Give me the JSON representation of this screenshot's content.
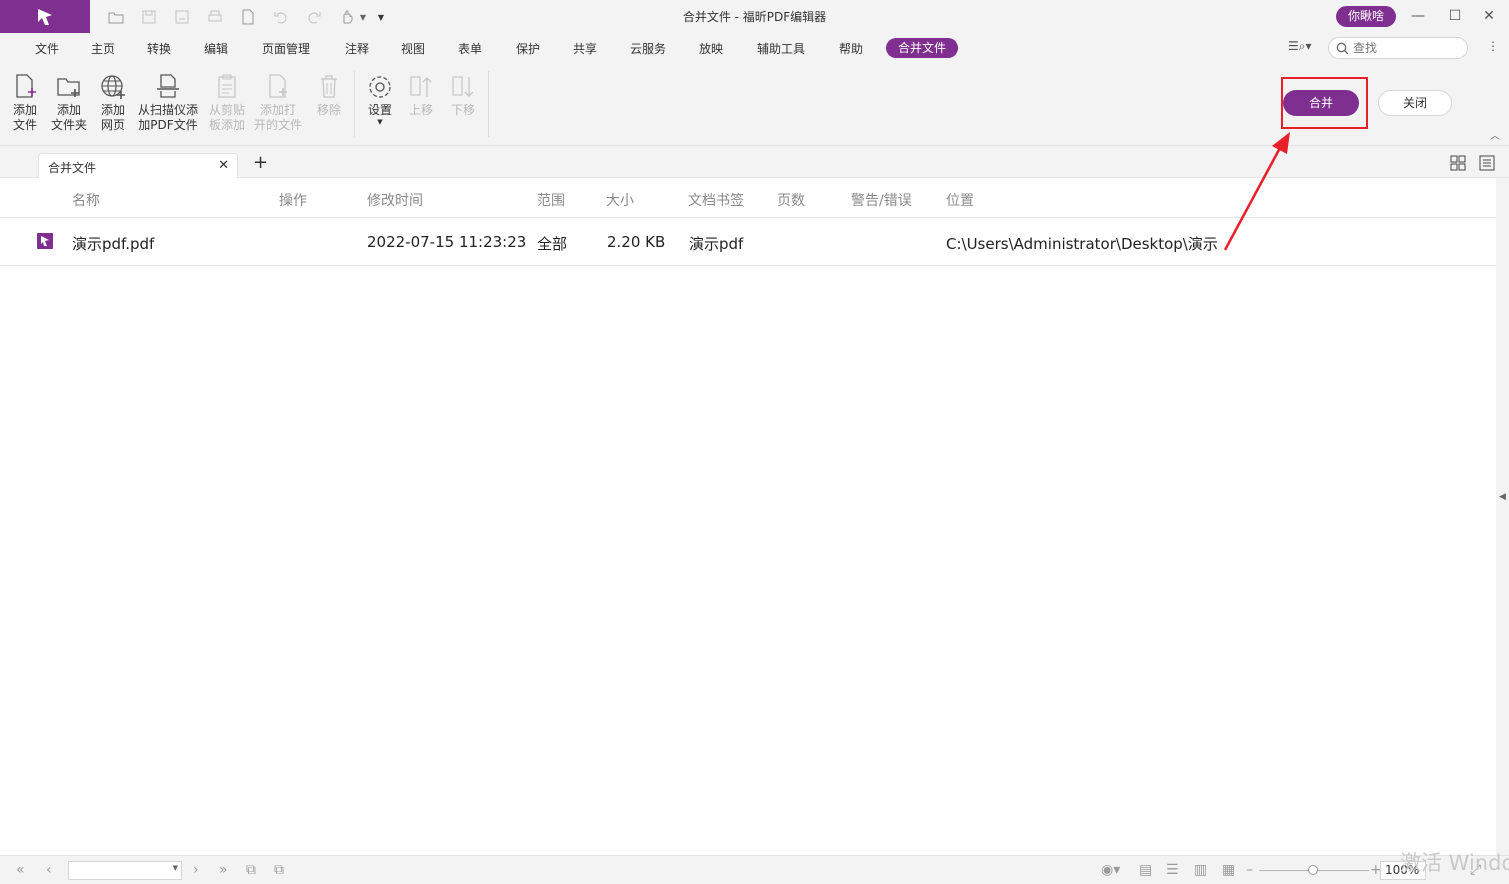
{
  "window": {
    "title": "合并文件 - 福昕PDF编辑器",
    "user_button": "你瞅啥",
    "controls": [
      "minimize-icon",
      "maximize-icon",
      "close-icon"
    ]
  },
  "quick_access": [
    "open-folder-icon",
    "save-icon",
    "save-as-icon",
    "print-icon",
    "new-file-icon",
    "undo-icon",
    "redo-icon",
    "hand-tool-icon",
    "customize-dropdown-icon"
  ],
  "menu": {
    "items": [
      "文件",
      "主页",
      "转换",
      "编辑",
      "页面管理",
      "注释",
      "视图",
      "表单",
      "保护",
      "共享",
      "云服务",
      "放映",
      "辅助工具",
      "帮助"
    ],
    "active": "合并文件"
  },
  "search": {
    "placeholder": "查找"
  },
  "ribbon": {
    "buttons": [
      {
        "label": "添加\n文件",
        "icon": "add-file-icon",
        "enabled": true
      },
      {
        "label": "添加\n文件夹",
        "icon": "add-folder-icon",
        "enabled": true
      },
      {
        "label": "添加\n网页",
        "icon": "add-webpage-icon",
        "enabled": true
      },
      {
        "label": "从扫描仪添\n加PDF文件",
        "icon": "scanner-icon",
        "enabled": true
      },
      {
        "label": "从剪贴\n板添加",
        "icon": "clipboard-icon",
        "enabled": false
      },
      {
        "label": "添加打\n开的文件",
        "icon": "open-files-icon",
        "enabled": false
      },
      {
        "label": "移除",
        "icon": "trash-icon",
        "enabled": false
      },
      {
        "label": "设置",
        "icon": "settings-icon",
        "enabled": true
      },
      {
        "label": "上移",
        "icon": "move-up-icon",
        "enabled": false
      },
      {
        "label": "下移",
        "icon": "move-down-icon",
        "enabled": false
      }
    ],
    "merge_label": "合并",
    "close_label": "关闭"
  },
  "tabs": [
    {
      "title": "合并文件"
    }
  ],
  "table": {
    "columns": [
      "名称",
      "操作",
      "修改时间",
      "范围",
      "大小",
      "文档书签",
      "页数",
      "警告/错误",
      "位置"
    ],
    "rows": [
      {
        "name": "演示pdf.pdf",
        "operation": "",
        "modified": "2022-07-15 11:23:23",
        "range": "全部",
        "size": "2.20 KB",
        "bookmark": "演示pdf",
        "pages": "",
        "warnings": "",
        "location": "C:\\Users\\Administrator\\Desktop\\演示"
      }
    ]
  },
  "status": {
    "zoom": "100%",
    "zoom_level": 0.5
  },
  "watermark": "激活 Windo",
  "colors": {
    "accent": "#7f2f8f",
    "highlight": "#e8202a",
    "chrome": "#f3f3f3"
  }
}
